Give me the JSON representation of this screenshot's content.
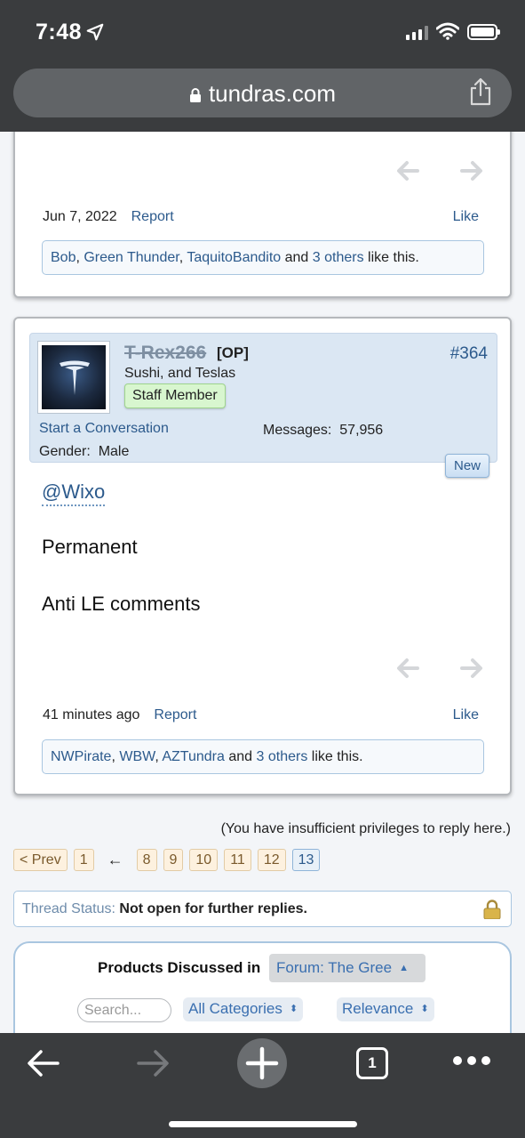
{
  "status_bar": {
    "time": "7:48"
  },
  "browser": {
    "url": "tundras.com"
  },
  "post1": {
    "date": "Jun 7, 2022",
    "report_label": "Report",
    "like_label": "Like",
    "likers": [
      "Bob",
      "Green Thunder",
      "TaquitoBandito"
    ],
    "and_text": "and",
    "others_link": "3 others",
    "like_suffix": "like this."
  },
  "post2": {
    "username": "T-Rex266",
    "op_tag": "[OP]",
    "user_title": "Sushi, and Teslas",
    "staff_badge": "Staff Member",
    "post_number": "#364",
    "start_conversation": "Start a Conversation",
    "messages_label": "Messages:",
    "messages_count": "57,956",
    "gender_label": "Gender:",
    "gender_value": "Male",
    "new_badge": "New",
    "mention": "@Wixo",
    "body": [
      "Permanent",
      "Anti LE comments"
    ],
    "time": "41 minutes ago",
    "report_label": "Report",
    "like_label": "Like",
    "likers": [
      "NWPirate",
      "WBW",
      "AZTundra"
    ],
    "and_text": "and",
    "others_link": "3 others",
    "like_suffix": "like this."
  },
  "privileges_note": "(You have insufficient privileges to reply here.)",
  "pagination": {
    "prev": "< Prev",
    "first": "1",
    "arrow": "←",
    "pages": [
      "8",
      "9",
      "10",
      "11",
      "12"
    ],
    "current": "13"
  },
  "thread_status": {
    "label": "Thread Status:",
    "value": "Not open for further replies."
  },
  "products": {
    "title": "Products Discussed in",
    "forum_select": "Forum: The Gree",
    "search_placeholder": "Search...",
    "category_select": "All Categories",
    "sort_select": "Relevance"
  },
  "toolbar": {
    "tab_count": "1"
  },
  "colors": {
    "accent": "#2c5a8c",
    "chrome": "#3a3c3e",
    "userinfo_bg": "#dbe7f3",
    "staff_bg": "#d8f6cf"
  }
}
